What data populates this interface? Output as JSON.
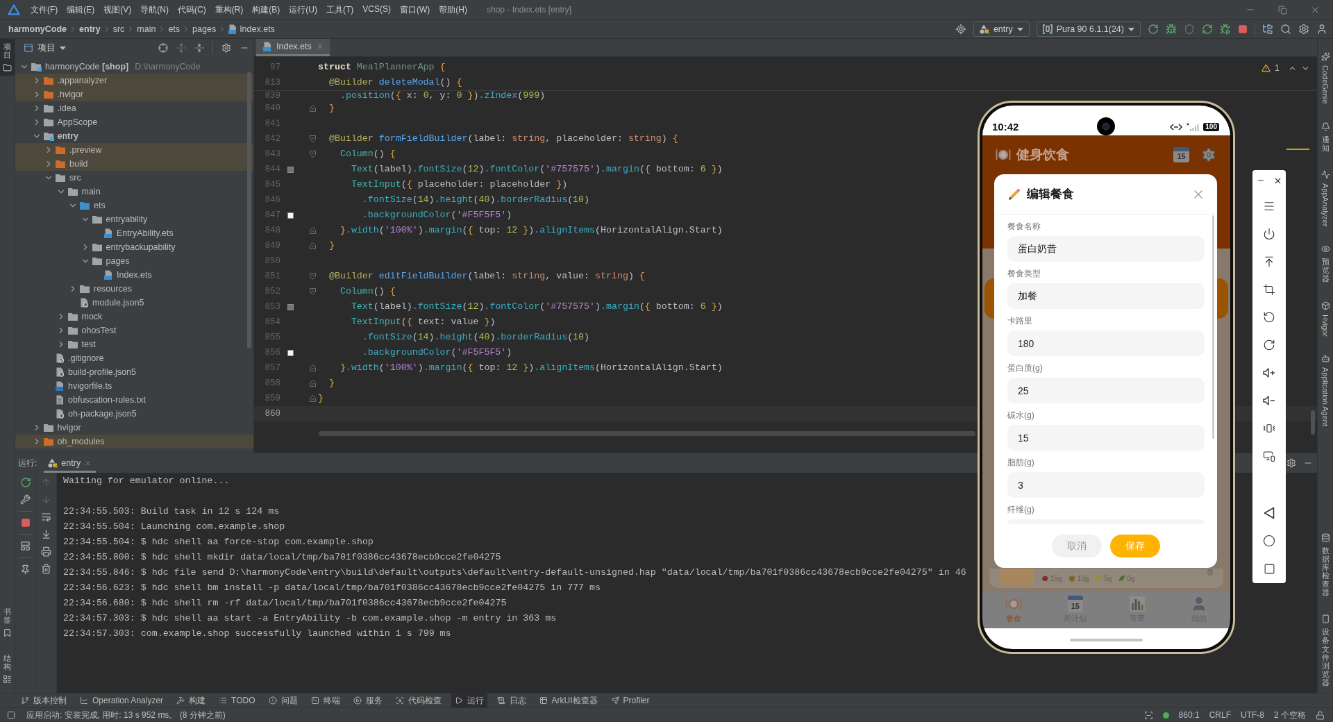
{
  "menu_bar": {
    "items": [
      "文件(F)",
      "编辑(E)",
      "视图(V)",
      "导航(N)",
      "代码(C)",
      "重构(R)",
      "构建(B)",
      "运行(U)",
      "工具(T)",
      "VCS(S)",
      "窗口(W)",
      "帮助(H)"
    ],
    "title": "shop - Index.ets [entry]"
  },
  "nav_bar": {
    "breadcrumb": [
      {
        "label": "harmonyCode",
        "kind": "module"
      },
      {
        "label": "entry",
        "kind": "module"
      },
      {
        "label": "src",
        "kind": "folder"
      },
      {
        "label": "main",
        "kind": "folder"
      },
      {
        "label": "ets",
        "kind": "folder"
      },
      {
        "label": "pages",
        "kind": "folder"
      },
      {
        "label": "Index.ets",
        "kind": "file"
      }
    ],
    "run_config": "entry",
    "device": "Pura 90 6.1.1(24)"
  },
  "left_strip": {
    "top": [
      {
        "label": "项目",
        "kind": "project",
        "selected": true
      }
    ],
    "bottom": [
      {
        "label": "书签",
        "kind": "bookmarks",
        "selected": false
      },
      {
        "label": "结构",
        "kind": "structure",
        "selected": false
      }
    ]
  },
  "project_panel": {
    "title": "项目",
    "tree": [
      {
        "label": "harmonyCode **[shop]**",
        "path": "D:\\harmonyCode",
        "kind": "project",
        "expanded": true,
        "children": [
          {
            "label": ".appanalyzer",
            "kind": "excluded",
            "expanded": false
          },
          {
            "label": ".hvigor",
            "kind": "excluded",
            "expanded": false
          },
          {
            "label": ".idea",
            "kind": "folder",
            "expanded": false
          },
          {
            "label": "AppScope",
            "kind": "folder",
            "expanded": false
          },
          {
            "label": "entry",
            "kind": "module",
            "expanded": true,
            "children": [
              {
                "label": ".preview",
                "kind": "excluded",
                "expanded": false
              },
              {
                "label": "build",
                "kind": "excluded",
                "expanded": false
              },
              {
                "label": "src",
                "kind": "folder",
                "expanded": true,
                "children": [
                  {
                    "label": "main",
                    "kind": "folder",
                    "expanded": true,
                    "children": [
                      {
                        "label": "ets",
                        "kind": "source",
                        "expanded": true,
                        "children": [
                          {
                            "label": "entryability",
                            "kind": "folder",
                            "expanded": true,
                            "children": [
                              {
                                "label": "EntryAbility.ets",
                                "kind": "file-ets"
                              }
                            ]
                          },
                          {
                            "label": "entrybackupability",
                            "kind": "folder",
                            "expanded": false
                          },
                          {
                            "label": "pages",
                            "kind": "folder",
                            "expanded": true,
                            "children": [
                              {
                                "label": "Index.ets",
                                "kind": "file-ets"
                              }
                            ]
                          }
                        ]
                      },
                      {
                        "label": "resources",
                        "kind": "folder",
                        "expanded": false
                      },
                      {
                        "label": "module.json5",
                        "kind": "file-json"
                      }
                    ]
                  },
                  {
                    "label": "mock",
                    "kind": "folder",
                    "expanded": false
                  },
                  {
                    "label": "ohosTest",
                    "kind": "folder",
                    "expanded": false
                  },
                  {
                    "label": "test",
                    "kind": "folder",
                    "expanded": false
                  }
                ]
              },
              {
                "label": ".gitignore",
                "kind": "file-ignore"
              },
              {
                "label": "build-profile.json5",
                "kind": "file-json"
              },
              {
                "label": "hvigorfile.ts",
                "kind": "file-ts"
              },
              {
                "label": "obfuscation-rules.txt",
                "kind": "file-text"
              },
              {
                "label": "oh-package.json5",
                "kind": "file-json"
              }
            ]
          },
          {
            "label": "hvigor",
            "kind": "folder",
            "expanded": false
          },
          {
            "label": "oh_modules",
            "kind": "excluded",
            "expanded": false
          }
        ]
      }
    ]
  },
  "editor": {
    "tabs": [
      {
        "label": "Index.ets",
        "selected": true
      }
    ],
    "problems": "1",
    "sticky_lines": [
      {
        "number": "97",
        "tokens": [
          {
            "text": "struct",
            "kind": "keyword"
          },
          {
            "text": " MealPlannerApp",
            "kind": "type"
          },
          {
            "text": " {",
            "kind": "brace"
          }
        ]
      },
      {
        "number": "813",
        "tokens": [
          {
            "text": "  @Builder",
            "kind": "decorator"
          },
          {
            "text": " deleteModal",
            "kind": "function"
          },
          {
            "text": "()",
            "kind": "plain"
          },
          {
            "text": " {",
            "kind": "brace"
          }
        ]
      }
    ],
    "lines": [
      {
        "number": "839",
        "kind": "plain",
        "current": false,
        "tokens": [
          {
            "text": "    .position",
            "kind": "method"
          },
          {
            "text": "(",
            "kind": "plain"
          },
          {
            "text": "{",
            "kind": "brace"
          },
          {
            "text": " x: ",
            "kind": "plain"
          },
          {
            "text": "0",
            "kind": "number"
          },
          {
            "text": ", y: ",
            "kind": "plain"
          },
          {
            "text": "0",
            "kind": "number"
          },
          {
            "text": " }",
            "kind": "brace"
          },
          {
            "text": ")",
            "kind": "plain"
          },
          {
            "text": ".zIndex",
            "kind": "method"
          },
          {
            "text": "(",
            "kind": "plain"
          },
          {
            "text": "999",
            "kind": "number"
          },
          {
            "text": ")",
            "kind": "plain"
          }
        ]
      },
      {
        "number": "840",
        "kind": "closer",
        "current": false,
        "tokens": [
          {
            "text": "  }",
            "kind": "brace"
          }
        ]
      },
      {
        "number": "841",
        "kind": "plain",
        "current": false
      },
      {
        "number": "842",
        "kind": "opener",
        "current": false,
        "tokens": [
          {
            "text": "  @Builder",
            "kind": "decorator"
          },
          {
            "text": " formFieldBuilder",
            "kind": "function"
          },
          {
            "text": "(label: ",
            "kind": "plain"
          },
          {
            "text": "string",
            "kind": "typeword"
          },
          {
            "text": ", placeholder: ",
            "kind": "plain"
          },
          {
            "text": "string",
            "kind": "typeword"
          },
          {
            "text": ")",
            "kind": "plain"
          },
          {
            "text": " {",
            "kind": "brace"
          }
        ]
      },
      {
        "number": "843",
        "kind": "opener",
        "current": false,
        "tokens": [
          {
            "text": "    Column",
            "kind": "component"
          },
          {
            "text": "()",
            "kind": "plain"
          },
          {
            "text": " {",
            "kind": "brace"
          }
        ]
      },
      {
        "number": "844",
        "kind": "plain",
        "current": false,
        "swatch": {
          "color": "#757575"
        },
        "tokens": [
          {
            "text": "      Text",
            "kind": "component"
          },
          {
            "text": "(label)",
            "kind": "plain"
          },
          {
            "text": ".fontSize",
            "kind": "method"
          },
          {
            "text": "(",
            "kind": "plain"
          },
          {
            "text": "12",
            "kind": "number"
          },
          {
            "text": ")",
            "kind": "plain"
          },
          {
            "text": ".fontColor",
            "kind": "method"
          },
          {
            "text": "(",
            "kind": "plain"
          },
          {
            "text": "'#757575'",
            "kind": "string"
          },
          {
            "text": ")",
            "kind": "plain"
          },
          {
            "text": ".margin",
            "kind": "method"
          },
          {
            "text": "(",
            "kind": "plain"
          },
          {
            "text": "{",
            "kind": "brace"
          },
          {
            "text": " bottom: ",
            "kind": "plain"
          },
          {
            "text": "6",
            "kind": "number"
          },
          {
            "text": " }",
            "kind": "brace"
          },
          {
            "text": ")",
            "kind": "plain"
          }
        ]
      },
      {
        "number": "845",
        "kind": "plain",
        "current": false,
        "tokens": [
          {
            "text": "      TextInput",
            "kind": "component"
          },
          {
            "text": "(",
            "kind": "plain"
          },
          {
            "text": "{",
            "kind": "brace"
          },
          {
            "text": " placeholder: placeholder",
            "kind": "plain"
          },
          {
            "text": " }",
            "kind": "brace"
          },
          {
            "text": ")",
            "kind": "plain"
          }
        ]
      },
      {
        "number": "846",
        "kind": "plain",
        "current": false,
        "tokens": [
          {
            "text": "        .fontSize",
            "kind": "method"
          },
          {
            "text": "(",
            "kind": "plain"
          },
          {
            "text": "14",
            "kind": "number"
          },
          {
            "text": ")",
            "kind": "plain"
          },
          {
            "text": ".height",
            "kind": "method"
          },
          {
            "text": "(",
            "kind": "plain"
          },
          {
            "text": "40",
            "kind": "number"
          },
          {
            "text": ")",
            "kind": "plain"
          },
          {
            "text": ".borderRadius",
            "kind": "method"
          },
          {
            "text": "(",
            "kind": "plain"
          },
          {
            "text": "10",
            "kind": "number"
          },
          {
            "text": ")",
            "kind": "plain"
          }
        ]
      },
      {
        "number": "847",
        "kind": "plain",
        "current": false,
        "swatch": {
          "color": "#f5f5f5"
        },
        "tokens": [
          {
            "text": "        .backgroundColor",
            "kind": "method"
          },
          {
            "text": "(",
            "kind": "plain"
          },
          {
            "text": "'#F5F5F5'",
            "kind": "string"
          },
          {
            "text": ")",
            "kind": "plain"
          }
        ]
      },
      {
        "number": "848",
        "kind": "closer",
        "current": false,
        "tokens": [
          {
            "text": "    }",
            "kind": "brace"
          },
          {
            "text": ".width",
            "kind": "method"
          },
          {
            "text": "(",
            "kind": "plain"
          },
          {
            "text": "'100%'",
            "kind": "string"
          },
          {
            "text": ")",
            "kind": "plain"
          },
          {
            "text": ".margin",
            "kind": "method"
          },
          {
            "text": "(",
            "kind": "plain"
          },
          {
            "text": "{",
            "kind": "brace"
          },
          {
            "text": " top: ",
            "kind": "plain"
          },
          {
            "text": "12",
            "kind": "number"
          },
          {
            "text": " }",
            "kind": "brace"
          },
          {
            "text": ")",
            "kind": "plain"
          },
          {
            "text": ".alignItems",
            "kind": "method"
          },
          {
            "text": "(HorizontalAlign.Start)",
            "kind": "plain"
          }
        ]
      },
      {
        "number": "849",
        "kind": "closer",
        "current": false,
        "tokens": [
          {
            "text": "  }",
            "kind": "brace"
          }
        ]
      },
      {
        "number": "850",
        "kind": "plain",
        "current": false
      },
      {
        "number": "851",
        "kind": "opener",
        "current": false,
        "tokens": [
          {
            "text": "  @Builder",
            "kind": "decorator"
          },
          {
            "text": " editFieldBuilder",
            "kind": "function"
          },
          {
            "text": "(label: ",
            "kind": "plain"
          },
          {
            "text": "string",
            "kind": "typeword"
          },
          {
            "text": ", value: ",
            "kind": "plain"
          },
          {
            "text": "string",
            "kind": "typeword"
          },
          {
            "text": ")",
            "kind": "plain"
          },
          {
            "text": " {",
            "kind": "brace"
          }
        ]
      },
      {
        "number": "852",
        "kind": "opener",
        "current": false,
        "tokens": [
          {
            "text": "    Column",
            "kind": "component"
          },
          {
            "text": "()",
            "kind": "plain"
          },
          {
            "text": " {",
            "kind": "brace"
          }
        ]
      },
      {
        "number": "853",
        "kind": "plain",
        "current": false,
        "swatch": {
          "color": "#757575"
        },
        "tokens": [
          {
            "text": "      Text",
            "kind": "component"
          },
          {
            "text": "(label)",
            "kind": "plain"
          },
          {
            "text": ".fontSize",
            "kind": "method"
          },
          {
            "text": "(",
            "kind": "plain"
          },
          {
            "text": "12",
            "kind": "number"
          },
          {
            "text": ")",
            "kind": "plain"
          },
          {
            "text": ".fontColor",
            "kind": "method"
          },
          {
            "text": "(",
            "kind": "plain"
          },
          {
            "text": "'#757575'",
            "kind": "string"
          },
          {
            "text": ")",
            "kind": "plain"
          },
          {
            "text": ".margin",
            "kind": "method"
          },
          {
            "text": "(",
            "kind": "plain"
          },
          {
            "text": "{",
            "kind": "brace"
          },
          {
            "text": " bottom: ",
            "kind": "plain"
          },
          {
            "text": "6",
            "kind": "number"
          },
          {
            "text": " }",
            "kind": "brace"
          },
          {
            "text": ")",
            "kind": "plain"
          }
        ]
      },
      {
        "number": "854",
        "kind": "plain",
        "current": false,
        "tokens": [
          {
            "text": "      TextInput",
            "kind": "component"
          },
          {
            "text": "(",
            "kind": "plain"
          },
          {
            "text": "{",
            "kind": "brace"
          },
          {
            "text": " text: value",
            "kind": "plain"
          },
          {
            "text": " }",
            "kind": "brace"
          },
          {
            "text": ")",
            "kind": "plain"
          }
        ]
      },
      {
        "number": "855",
        "kind": "plain",
        "current": false,
        "tokens": [
          {
            "text": "        .fontSize",
            "kind": "method"
          },
          {
            "text": "(",
            "kind": "plain"
          },
          {
            "text": "14",
            "kind": "number"
          },
          {
            "text": ")",
            "kind": "plain"
          },
          {
            "text": ".height",
            "kind": "method"
          },
          {
            "text": "(",
            "kind": "plain"
          },
          {
            "text": "40",
            "kind": "number"
          },
          {
            "text": ")",
            "kind": "plain"
          },
          {
            "text": ".borderRadius",
            "kind": "method"
          },
          {
            "text": "(",
            "kind": "plain"
          },
          {
            "text": "10",
            "kind": "number"
          },
          {
            "text": ")",
            "kind": "plain"
          }
        ]
      },
      {
        "number": "856",
        "kind": "plain",
        "current": false,
        "swatch": {
          "color": "#f5f5f5"
        },
        "tokens": [
          {
            "text": "        .backgroundColor",
            "kind": "method"
          },
          {
            "text": "(",
            "kind": "plain"
          },
          {
            "text": "'#F5F5F5'",
            "kind": "string"
          },
          {
            "text": ")",
            "kind": "plain"
          }
        ]
      },
      {
        "number": "857",
        "kind": "closer",
        "current": false,
        "tokens": [
          {
            "text": "    }",
            "kind": "brace"
          },
          {
            "text": ".width",
            "kind": "method"
          },
          {
            "text": "(",
            "kind": "plain"
          },
          {
            "text": "'100%'",
            "kind": "string"
          },
          {
            "text": ")",
            "kind": "plain"
          },
          {
            "text": ".margin",
            "kind": "method"
          },
          {
            "text": "(",
            "kind": "plain"
          },
          {
            "text": "{",
            "kind": "brace"
          },
          {
            "text": " top: ",
            "kind": "plain"
          },
          {
            "text": "12",
            "kind": "number"
          },
          {
            "text": " }",
            "kind": "brace"
          },
          {
            "text": ")",
            "kind": "plain"
          },
          {
            "text": ".alignItems",
            "kind": "method"
          },
          {
            "text": "(HorizontalAlign.Start)",
            "kind": "plain"
          }
        ]
      },
      {
        "number": "858",
        "kind": "closer",
        "current": false,
        "tokens": [
          {
            "text": "  }",
            "kind": "brace"
          }
        ]
      },
      {
        "number": "859",
        "kind": "closer",
        "current": false,
        "tokens": [
          {
            "text": "}",
            "kind": "brace"
          }
        ]
      },
      {
        "number": "860",
        "kind": "plain",
        "current": true
      }
    ]
  },
  "run_panel": {
    "title": "运行:",
    "tabs": [
      {
        "label": "entry",
        "selected": true
      }
    ],
    "output_blocks": [
      {
        "lines": [
          "Waiting for emulator online..."
        ]
      },
      {
        "lines": [
          "22:34:55.503: Build task in 12 s 124 ms",
          "22:34:55.504: Launching com.example.shop",
          "22:34:55.504: $ hdc shell aa force-stop com.example.shop",
          "22:34:55.800: $ hdc shell mkdir data/local/tmp/ba701f0386cc43678ecb9cce2fe04275",
          "22:34:55.846: $ hdc file send D:\\harmonyCode\\entry\\build\\default\\outputs\\default\\entry-default-unsigned.hap \"data/local/tmp/ba701f0386cc43678ecb9cce2fe04275\" in 46",
          "22:34:56.623: $ hdc shell bm install -p data/local/tmp/ba701f0386cc43678ecb9cce2fe04275 in 777 ms",
          "22:34:56.680: $ hdc shell rm -rf data/local/tmp/ba701f0386cc43678ecb9cce2fe04275",
          "22:34:57.303: $ hdc shell aa start -a EntryAbility -b com.example.shop -m entry in 363 ms",
          "22:34:57.303: com.example.shop successfully launched within 1 s 799 ms"
        ]
      }
    ]
  },
  "right_strip": {
    "top": [
      {
        "label": "CodeGenie",
        "kind": "codegenie",
        "rotated": true
      },
      {
        "label": "通知",
        "kind": "notifications",
        "rotated": false
      },
      {
        "label": "AppAnalyzer",
        "kind": "analyzer",
        "rotated": true
      },
      {
        "label": "预览器",
        "kind": "previewer",
        "rotated": false
      },
      {
        "label": "Hvigor",
        "kind": "hvigor",
        "rotated": true
      },
      {
        "label": "Application Agent",
        "kind": "agent",
        "rotated": true
      }
    ],
    "bottom": [
      {
        "label": "数据库检查器",
        "kind": "database",
        "rotated": false
      },
      {
        "label": "设备文件浏览器",
        "kind": "device-files",
        "rotated": false
      }
    ]
  },
  "bottom_tabs": [
    {
      "label": "版本控制",
      "kind": "vcs",
      "selected": false
    },
    {
      "label": "Operation Analyzer",
      "kind": "analyzer",
      "selected": false
    },
    {
      "label": "构建",
      "kind": "build",
      "selected": false
    },
    {
      "label": "TODO",
      "kind": "todo",
      "selected": false
    },
    {
      "label": "问题",
      "kind": "problems",
      "selected": false
    },
    {
      "label": "终端",
      "kind": "terminal",
      "selected": false
    },
    {
      "label": "服务",
      "kind": "services",
      "selected": false
    },
    {
      "label": "代码检查",
      "kind": "inspection",
      "selected": false
    },
    {
      "label": "运行",
      "kind": "run",
      "selected": true
    },
    {
      "label": "日志",
      "kind": "log",
      "selected": false
    },
    {
      "label": "ArkUI检查器",
      "kind": "inspector",
      "selected": false
    },
    {
      "label": "Profiler",
      "kind": "profiler",
      "selected": false
    }
  ],
  "status_bar": {
    "message": "应用启动: 安装完成, 用时: 13 s 952 ms。 (8 分钟之前)",
    "position": "860:1",
    "line_ending": "CRLF",
    "encoding": "UTF-8",
    "indent": "2 个空格"
  },
  "emulator": {
    "status_bar": {
      "time": "10:42",
      "battery": "100"
    },
    "app": {
      "title": "健身饮食",
      "calendar_day": "15",
      "nutrients": [
        {
          "label": "15g",
          "kind": "protein"
        },
        {
          "label": "12g",
          "kind": "carbs"
        },
        {
          "label": "5g",
          "kind": "fat"
        },
        {
          "label": "0g",
          "kind": "fiber"
        }
      ],
      "nav": [
        {
          "label": "餐食",
          "kind": "meals",
          "selected": true
        },
        {
          "label": "周计划",
          "kind": "plan",
          "icon_text": "15",
          "selected": false
        },
        {
          "label": "营养",
          "kind": "nutrition",
          "selected": false
        },
        {
          "label": "我的",
          "kind": "profile",
          "selected": false
        }
      ]
    },
    "dialog": {
      "title": "编辑餐食",
      "fields": [
        {
          "label": "餐食名称",
          "value": "蛋白奶昔"
        },
        {
          "label": "餐食类型",
          "value": "加餐"
        },
        {
          "label": "卡路里",
          "value": "180"
        },
        {
          "label": "蛋白质(g)",
          "value": "25"
        },
        {
          "label": "碳水(g)",
          "value": "15"
        },
        {
          "label": "脂肪(g)",
          "value": "3"
        },
        {
          "label": "纤维(g)"
        }
      ],
      "buttons": [
        {
          "label": "取消",
          "kind": "cancel"
        },
        {
          "label": "保存",
          "kind": "primary"
        }
      ]
    }
  }
}
